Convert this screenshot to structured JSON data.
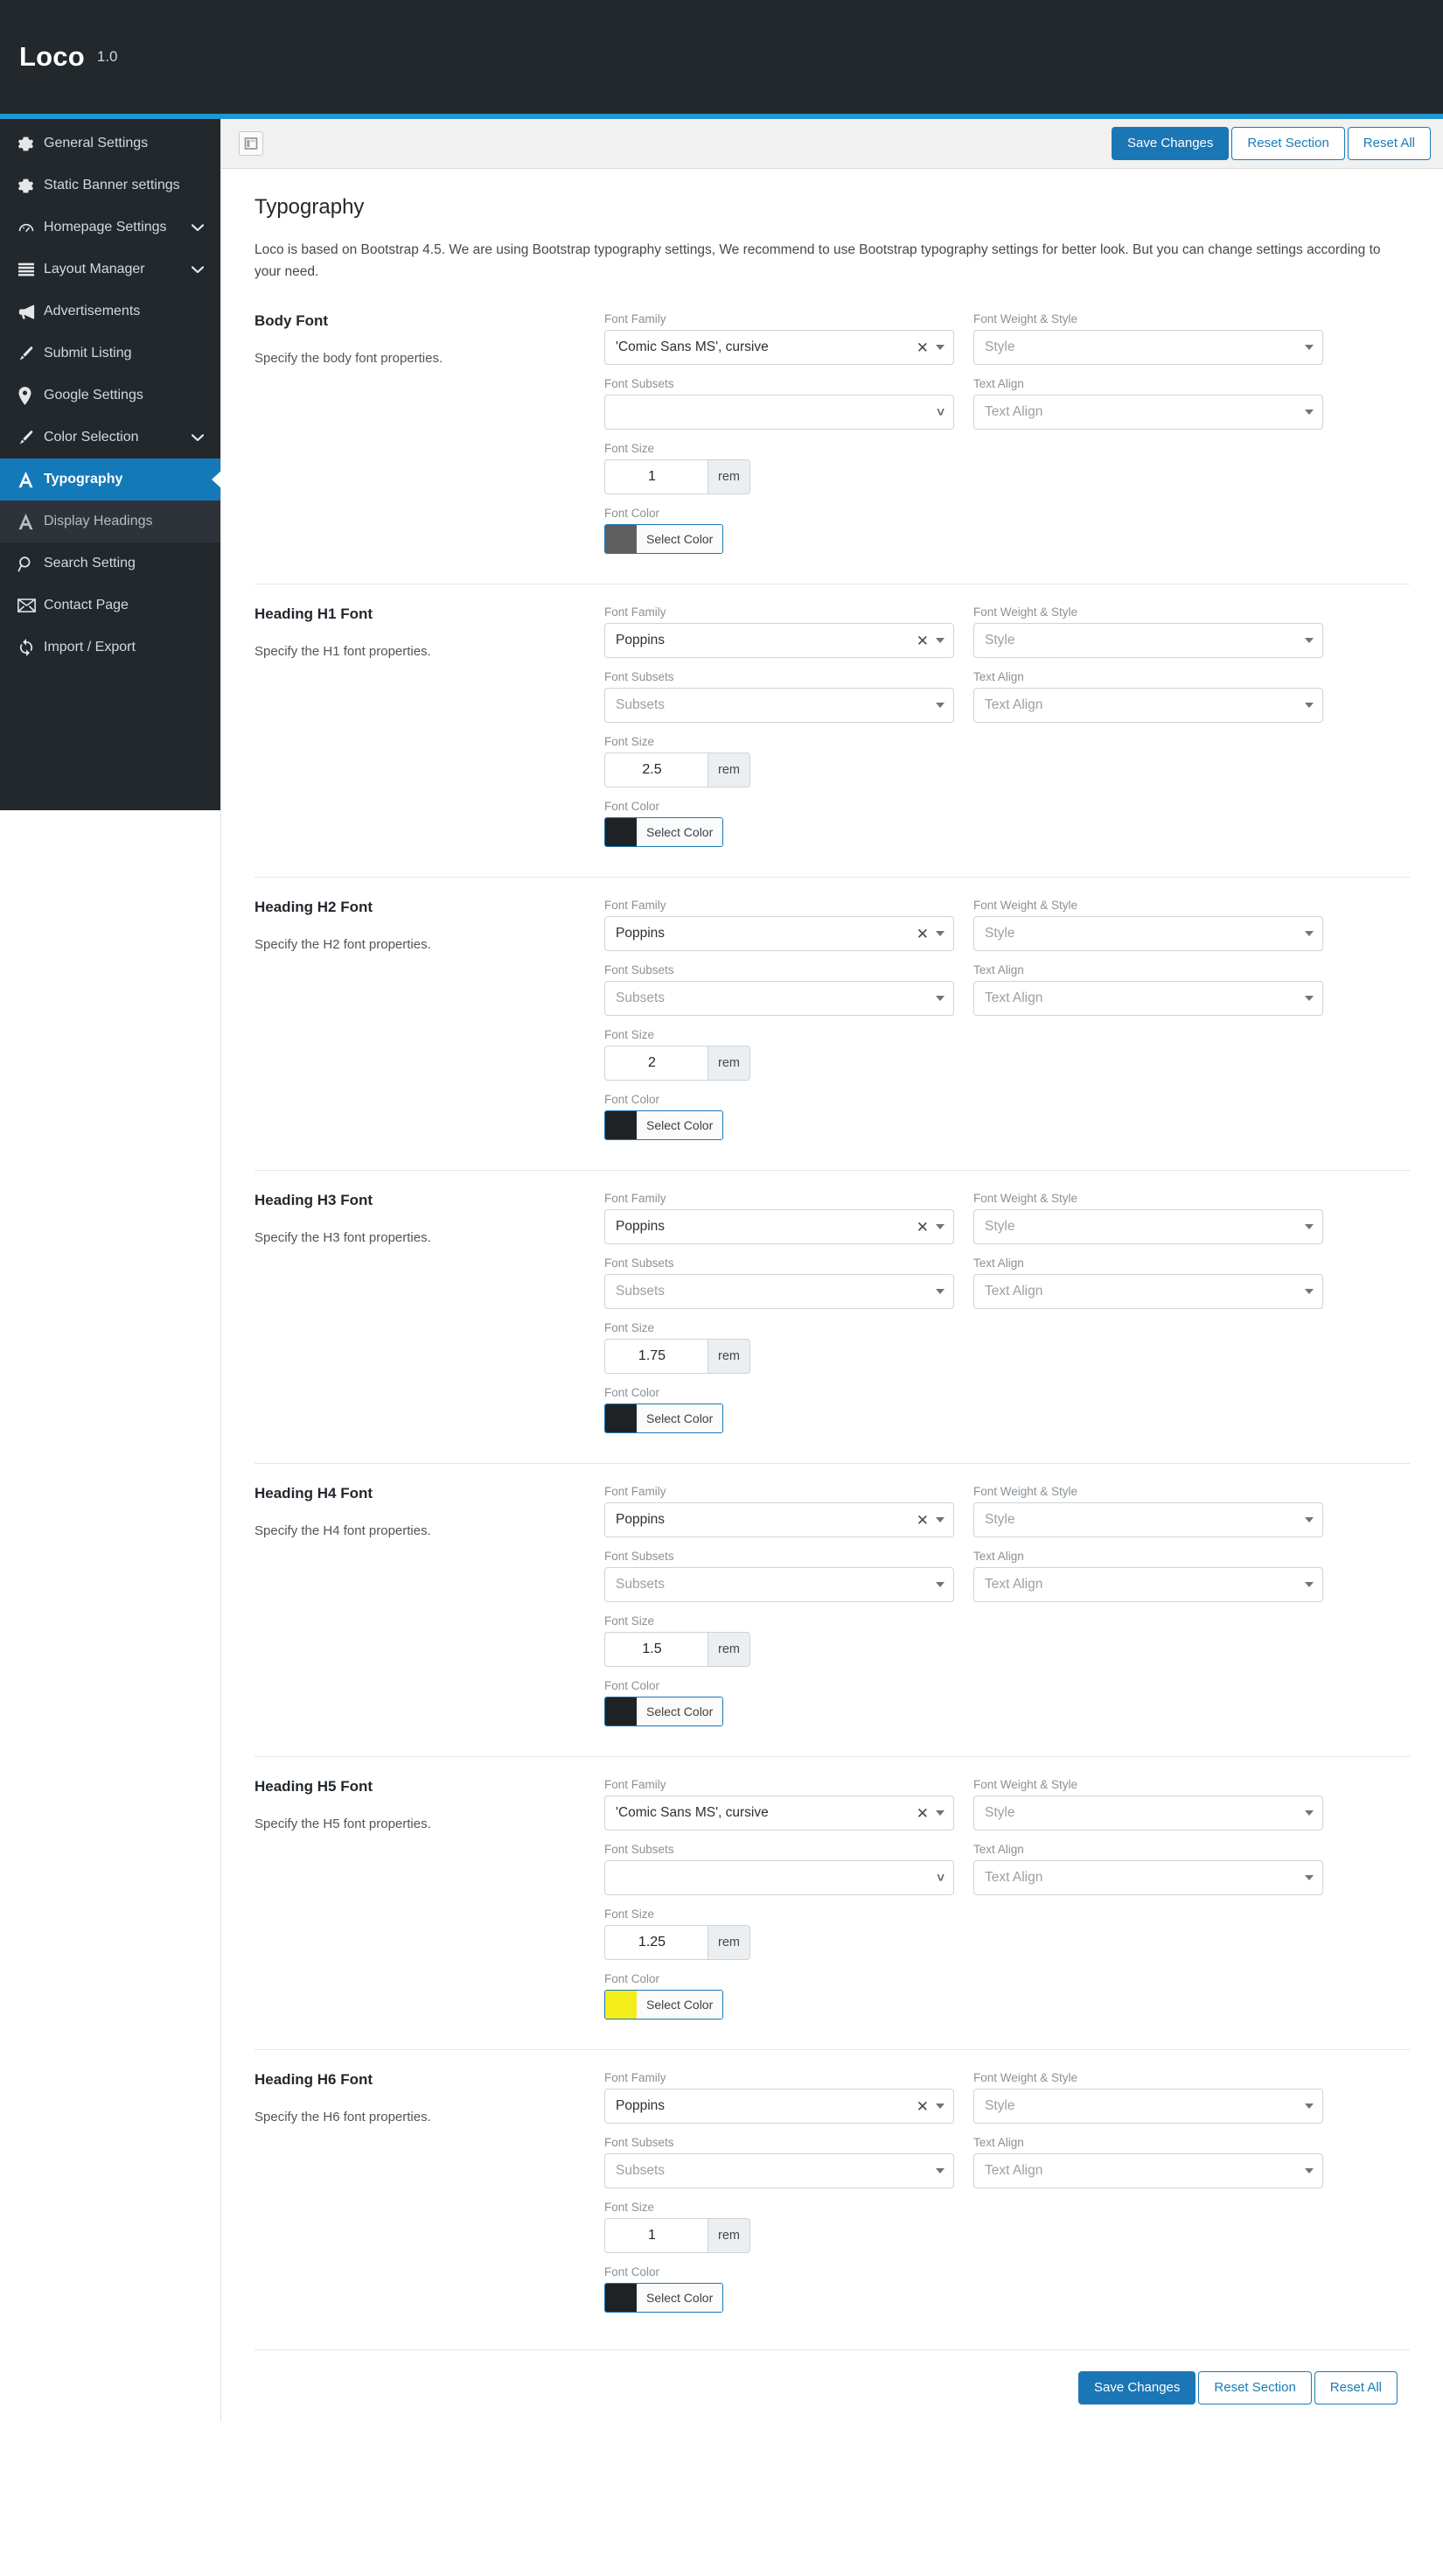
{
  "header": {
    "brand": "Loco",
    "version": "1.0"
  },
  "sidebar": {
    "items": [
      {
        "label": "General Settings",
        "icon": "gear-icon",
        "chevron": false,
        "active": false,
        "sub": false
      },
      {
        "label": "Static Banner settings",
        "icon": "gear-icon",
        "chevron": false,
        "active": false,
        "sub": false
      },
      {
        "label": "Homepage Settings",
        "icon": "gauge-icon",
        "chevron": true,
        "active": false,
        "sub": false
      },
      {
        "label": "Layout Manager",
        "icon": "layers-icon",
        "chevron": true,
        "active": false,
        "sub": false
      },
      {
        "label": "Advertisements",
        "icon": "megaphone-icon",
        "chevron": false,
        "active": false,
        "sub": false
      },
      {
        "label": "Submit Listing",
        "icon": "brush-icon",
        "chevron": false,
        "active": false,
        "sub": false
      },
      {
        "label": "Google Settings",
        "icon": "map-pin-icon",
        "chevron": false,
        "active": false,
        "sub": false
      },
      {
        "label": "Color Selection",
        "icon": "brush-icon",
        "chevron": true,
        "active": false,
        "sub": false
      },
      {
        "label": "Typography",
        "icon": "font-a-icon",
        "chevron": false,
        "active": true,
        "sub": false
      },
      {
        "label": "Display Headings",
        "icon": "font-a-icon",
        "chevron": false,
        "active": false,
        "sub": true
      },
      {
        "label": "Search Setting",
        "icon": "search-icon",
        "chevron": false,
        "active": false,
        "sub": false
      },
      {
        "label": "Contact Page",
        "icon": "envelope-icon",
        "chevron": false,
        "active": false,
        "sub": false
      },
      {
        "label": "Import / Export",
        "icon": "sync-icon",
        "chevron": false,
        "active": false,
        "sub": false
      }
    ]
  },
  "toolbar": {
    "expand_icon": "panel-layout-icon",
    "save_label": "Save Changes",
    "reset_section_label": "Reset Section",
    "reset_all_label": "Reset All"
  },
  "page": {
    "title": "Typography",
    "description": "Loco is based on Bootstrap 4.5. We are using Bootstrap typography settings, We recommend to use Bootstrap typography settings for better look. But you can change settings according to your need."
  },
  "labels": {
    "font_family": "Font Family",
    "font_subsets": "Font Subsets",
    "font_size": "Font Size",
    "font_color": "Font Color",
    "font_weight_style": "Font Weight & Style",
    "text_align": "Text Align",
    "style_placeholder": "Style",
    "text_align_placeholder": "Text Align",
    "subsets_placeholder": "Subsets",
    "select_color": "Select Color",
    "unit": "rem",
    "clear_icon": "clear-x-icon"
  },
  "sections": [
    {
      "title": "Body Font",
      "subtitle": "Specify the body font properties.",
      "font_family": "'Comic Sans MS', cursive",
      "font_family_clearable": true,
      "font_subsets": "",
      "font_subsets_placeholder": "",
      "font_size": "1",
      "font_color": "#5e5e5e",
      "weight_style": "Style",
      "text_align": "Text Align"
    },
    {
      "title": "Heading H1 Font",
      "subtitle": "Specify the H1 font properties.",
      "font_family": "Poppins",
      "font_family_clearable": true,
      "font_subsets": "",
      "font_subsets_placeholder": "Subsets",
      "font_size": "2.5",
      "font_color": "#1f2225",
      "weight_style": "Style",
      "text_align": "Text Align"
    },
    {
      "title": "Heading H2 Font",
      "subtitle": "Specify the H2 font properties.",
      "font_family": "Poppins",
      "font_family_clearable": true,
      "font_subsets": "",
      "font_subsets_placeholder": "Subsets",
      "font_size": "2",
      "font_color": "#1f2225",
      "weight_style": "Style",
      "text_align": "Text Align"
    },
    {
      "title": "Heading H3 Font",
      "subtitle": "Specify the H3 font properties.",
      "font_family": "Poppins",
      "font_family_clearable": true,
      "font_subsets": "",
      "font_subsets_placeholder": "Subsets",
      "font_size": "1.75",
      "font_color": "#1f2225",
      "weight_style": "Style",
      "text_align": "Text Align"
    },
    {
      "title": "Heading H4 Font",
      "subtitle": "Specify the H4 font properties.",
      "font_family": "Poppins",
      "font_family_clearable": true,
      "font_subsets": "",
      "font_subsets_placeholder": "Subsets",
      "font_size": "1.5",
      "font_color": "#1f2225",
      "weight_style": "Style",
      "text_align": "Text Align"
    },
    {
      "title": "Heading H5 Font",
      "subtitle": "Specify the H5 font properties.",
      "font_family": "'Comic Sans MS', cursive",
      "font_family_clearable": true,
      "font_subsets": "",
      "font_subsets_placeholder": "",
      "font_size": "1.25",
      "font_color": "#f3ed1b",
      "weight_style": "Style",
      "text_align": "Text Align"
    },
    {
      "title": "Heading H6 Font",
      "subtitle": "Specify the H6 font properties.",
      "font_family": "Poppins",
      "font_family_clearable": true,
      "font_subsets": "",
      "font_subsets_placeholder": "Subsets",
      "font_size": "1",
      "font_color": "#1f2225",
      "weight_style": "Style",
      "text_align": "Text Align"
    }
  ],
  "colors": {
    "accent": "#1b76b5",
    "sidebar_bg": "#22282c",
    "topbar_accent": "#2196cf"
  }
}
